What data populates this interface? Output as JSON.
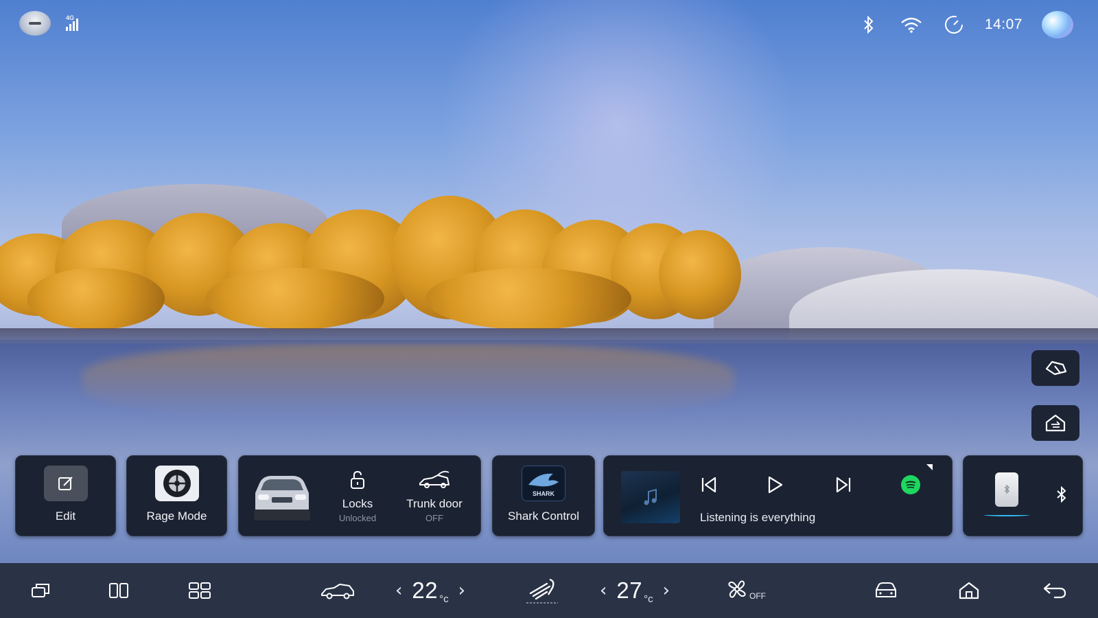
{
  "status_bar": {
    "network": "4G",
    "time": "14:07",
    "icons": [
      "menu-icon",
      "cellular-signal-icon",
      "bluetooth-icon",
      "wifi-icon",
      "speedometer-icon",
      "voice-assistant-icon"
    ]
  },
  "floating_buttons": [
    "car-brush-icon",
    "home-switch-icon"
  ],
  "cards": {
    "edit": {
      "label": "Edit",
      "icon": "edit-icon"
    },
    "rage_mode": {
      "label": "Rage Mode",
      "icon": "wheel-icon"
    },
    "vehicle": {
      "locks_label": "Locks",
      "locks_status": "Unlocked",
      "trunk_label": "Trunk door",
      "trunk_status": "OFF"
    },
    "shark_control": {
      "label": "Shark Control",
      "logo_text": "SHARK"
    },
    "media": {
      "track_title": "Listening is everything",
      "controls": [
        "previous-icon",
        "play-icon",
        "next-icon",
        "spotify-icon"
      ]
    },
    "bluetooth": {
      "icon": "bluetooth-icon"
    }
  },
  "dock": {
    "driver_temp": "22",
    "passenger_temp": "27",
    "temp_unit": "°c",
    "fan_status": "OFF",
    "icons": [
      "recent-apps-icon",
      "split-screen-icon",
      "app-grid-icon",
      "car-icon",
      "climate-seat-icon",
      "fan-icon",
      "car-front-icon",
      "home-icon",
      "back-icon"
    ]
  },
  "colors": {
    "card_bg": "#1b2232",
    "dock_bg": "#2a3346",
    "spotify_green": "#1ed760",
    "accent_blue": "#33b9f2"
  }
}
